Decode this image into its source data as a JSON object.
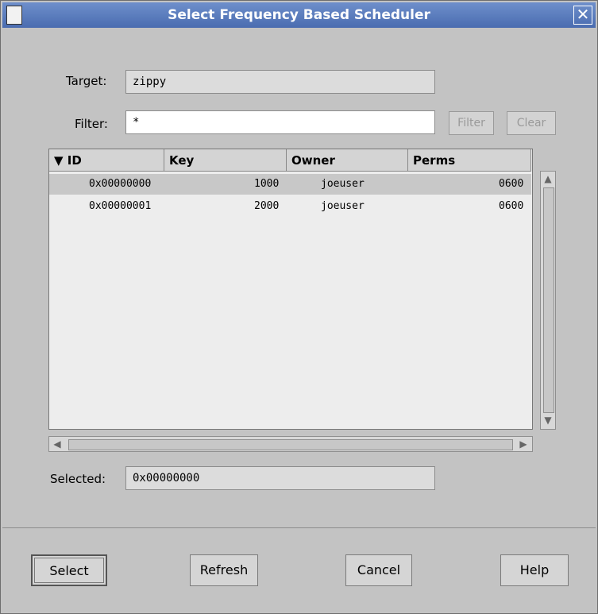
{
  "window": {
    "title": "Select Frequency Based Scheduler",
    "close_symbol": "✕"
  },
  "form": {
    "target_label": "Target:",
    "target_value": "zippy",
    "filter_label": "Filter:",
    "filter_value": "*",
    "filter_button": "Filter",
    "clear_button": "Clear",
    "selected_label": "Selected:",
    "selected_value": "0x00000000"
  },
  "table": {
    "sort_indicator": "▼",
    "columns": [
      "ID",
      "Key",
      "Owner",
      "Perms"
    ],
    "rows": [
      {
        "id": "0x00000000",
        "key": "1000",
        "owner": "joeuser",
        "perms": "0600",
        "selected": true
      },
      {
        "id": "0x00000001",
        "key": "2000",
        "owner": "joeuser",
        "perms": "0600",
        "selected": false
      }
    ]
  },
  "buttons": {
    "select": "Select",
    "refresh": "Refresh",
    "cancel": "Cancel",
    "help": "Help"
  },
  "icons": {
    "window": "window-icon",
    "close": "close-icon",
    "sort": "sort-desc-icon"
  }
}
